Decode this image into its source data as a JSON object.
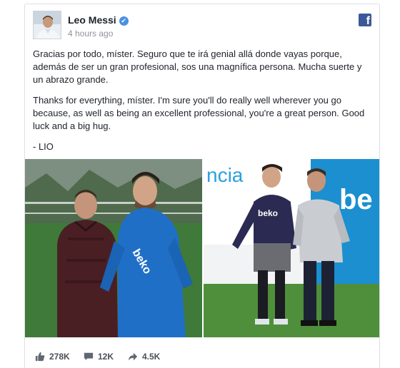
{
  "post": {
    "author": "Leo Messi",
    "verified_icon": "verified-check-icon",
    "timestamp": "4 hours ago",
    "brand_icon": "facebook-logo-icon",
    "paragraphs": {
      "spanish": "Gracias por todo, míster. Seguro que te irá genial allá donde vayas porque, además de ser un gran profesional, sos una magnífica persona. Mucha suerte y un abrazo grande.",
      "english": "Thanks for everything, míster. I'm sure you'll do really well wherever you go because, as well as being an excellent professional, you're a great person. Good luck and a big hug.",
      "signature": "- LIO"
    }
  },
  "photos": {
    "left": {
      "shirt_text": "beko"
    },
    "right": {
      "wall_text": "ncia",
      "wall_text_2": "be",
      "shirt_text": "beko"
    }
  },
  "stats": {
    "likes": {
      "icon": "like-icon",
      "count": "278K"
    },
    "comments": {
      "icon": "comment-icon",
      "count": "12K"
    },
    "shares": {
      "icon": "share-icon",
      "count": "4.5K"
    }
  },
  "colors": {
    "facebook_blue": "#3b5998",
    "verified_blue": "#4a90e2",
    "meta_text": "#90949c",
    "stats_text": "#4b4f56"
  }
}
